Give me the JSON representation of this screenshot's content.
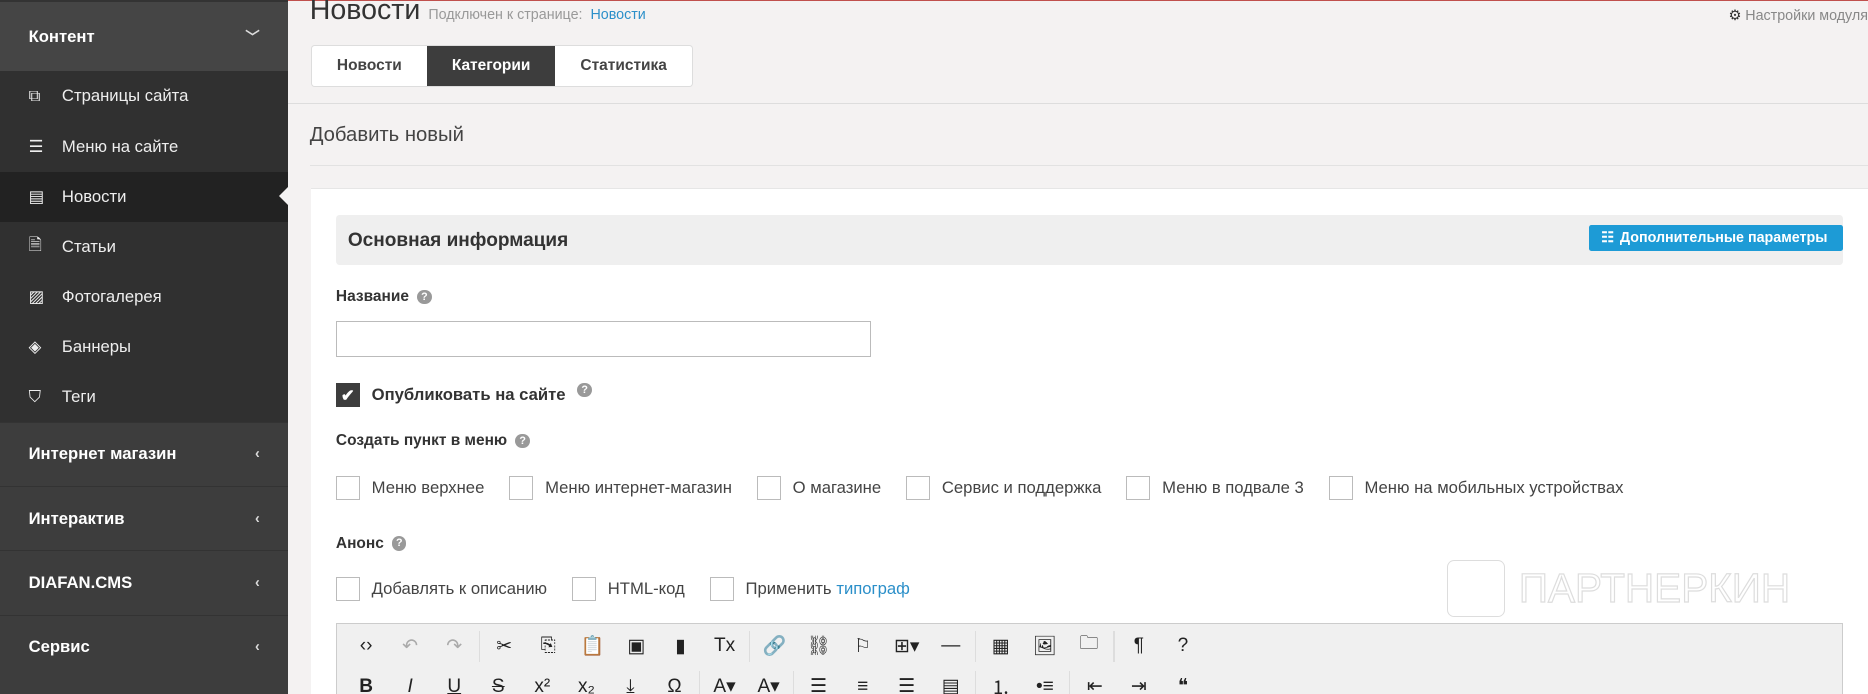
{
  "sidebar": {
    "content_section": "Контент",
    "items": [
      {
        "label": "Страницы сайта",
        "icon": "pages-icon",
        "glyph": "⧉"
      },
      {
        "label": "Меню на сайте",
        "icon": "list-icon",
        "glyph": "☰"
      },
      {
        "label": "Новости",
        "icon": "newspaper-icon",
        "glyph": "▤",
        "active": true
      },
      {
        "label": "Статьи",
        "icon": "file-icon",
        "glyph": "🗎"
      },
      {
        "label": "Фотогалерея",
        "icon": "image-icon",
        "glyph": "▨"
      },
      {
        "label": "Баннеры",
        "icon": "ticket-icon",
        "glyph": "◈"
      },
      {
        "label": "Теги",
        "icon": "tags-icon",
        "glyph": "⛉"
      }
    ],
    "sections": [
      "Интернет магазин",
      "Интерактив",
      "DIAFAN.CMS",
      "Сервис"
    ]
  },
  "header": {
    "title": "Новости",
    "connected_label": "Подключен к странице:",
    "connected_link": "Новости",
    "settings": "Настройки модуля"
  },
  "tabs": [
    "Новости",
    "Категории",
    "Статистика"
  ],
  "add_new": "Добавить новый",
  "form": {
    "section_title": "Основная информация",
    "extra_params": "Дополнительные параметры",
    "name_label": "Название",
    "name_value": "",
    "publish_label": "Опубликовать на сайте",
    "publish_checked": true,
    "menu_label": "Создать пункт в меню",
    "menus": [
      "Меню верхнее",
      "Меню интернет-магазин",
      "О магазине",
      "Сервис и поддержка",
      "Меню в подвале 3",
      "Меню на мобильных устройствах"
    ],
    "anons_label": "Анонс",
    "anons_opts": [
      "Добавлять к описанию",
      "HTML-код",
      "Применить"
    ],
    "typograph_link": "типограф"
  },
  "toolbar": {
    "row1": [
      [
        "source-icon",
        "‹›"
      ],
      [
        "undo-icon",
        "↶"
      ],
      [
        "redo-icon",
        "↷"
      ],
      "|",
      [
        "cut-icon",
        "✂"
      ],
      [
        "copy-icon",
        "⎘"
      ],
      [
        "paste-icon",
        "📋"
      ],
      [
        "paste-text-icon",
        "▣"
      ],
      [
        "paste-word-icon",
        "▮"
      ],
      [
        "remove-format-icon",
        "Tx"
      ],
      "|",
      [
        "link-icon",
        "🔗"
      ],
      [
        "unlink-icon",
        "⛓"
      ],
      [
        "anchor-icon",
        "⚐"
      ],
      [
        "table-icon",
        "⊞▾"
      ],
      [
        "hr-icon",
        "—"
      ],
      "|",
      [
        "media-icon",
        "▦"
      ],
      [
        "image-icon",
        "🖼"
      ],
      [
        "file-browser-icon",
        "🗀"
      ],
      "|",
      [
        "paragraph-icon",
        "¶"
      ],
      [
        "help-icon",
        "?"
      ]
    ],
    "row2": [
      [
        "bold-icon",
        "B"
      ],
      [
        "italic-icon",
        "I"
      ],
      [
        "underline-icon",
        "U"
      ],
      [
        "strike-icon",
        "S"
      ],
      [
        "superscript-icon",
        "x²"
      ],
      [
        "subscript-icon",
        "x₂"
      ],
      [
        "insert-icon",
        "⤓"
      ],
      [
        "special-char-icon",
        "Ω"
      ],
      "|",
      [
        "text-color-icon",
        "A▾"
      ],
      [
        "bg-color-icon",
        "A▾"
      ],
      "|",
      [
        "align-left-icon",
        "☰"
      ],
      [
        "align-center-icon",
        "≡"
      ],
      [
        "align-right-icon",
        "☰"
      ],
      [
        "justify-icon",
        "▤"
      ],
      "|",
      [
        "ordered-list-icon",
        "⒈"
      ],
      [
        "unordered-list-icon",
        "•≡"
      ],
      "|",
      [
        "outdent-icon",
        "⇤"
      ],
      [
        "indent-icon",
        "⇥"
      ],
      [
        "blockquote-icon",
        "❝"
      ]
    ]
  },
  "watermark": "ПАРТНЕРКИН"
}
